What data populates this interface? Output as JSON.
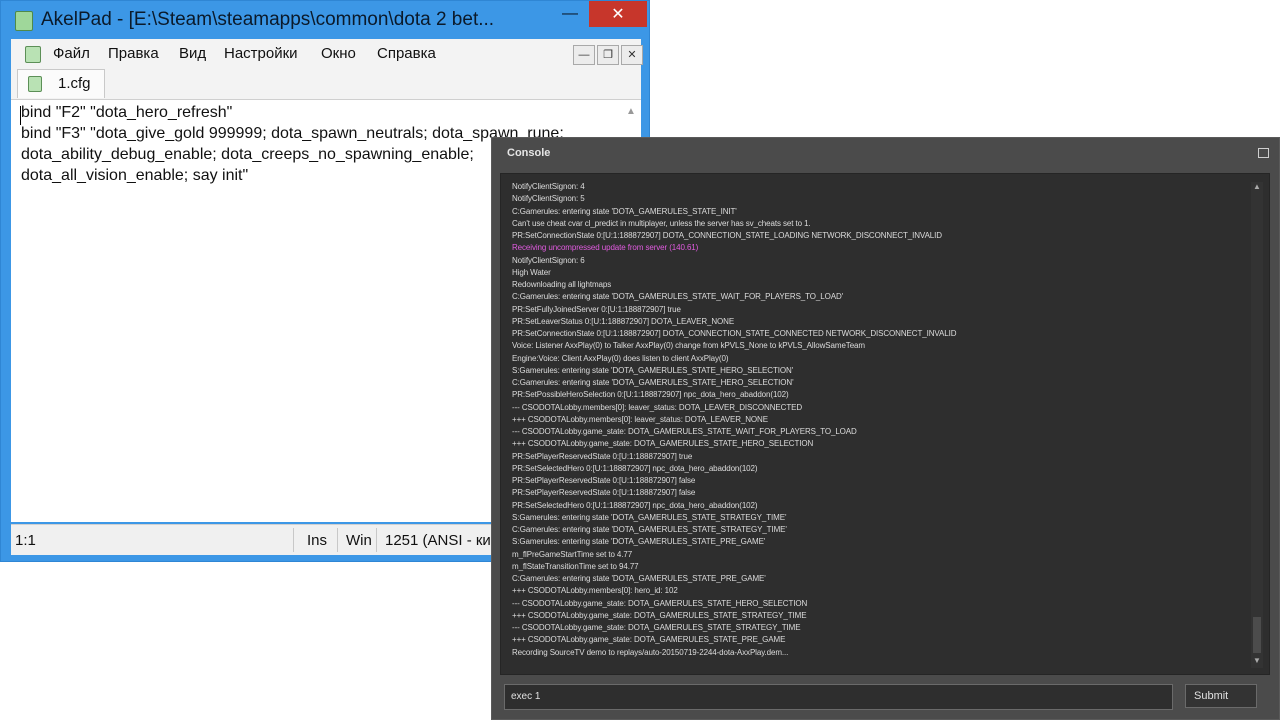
{
  "akelpad": {
    "title": "AkelPad - [E:\\Steam\\steamapps\\common\\dota 2 bet...",
    "controls": {
      "minimize": "—",
      "maximize": "☐",
      "close": "✕"
    },
    "menu": [
      "Файл",
      "Правка",
      "Вид",
      "Настройки",
      "Окно",
      "Справка"
    ],
    "mdi": {
      "minimize": "—",
      "restore": "❐",
      "close": "✕"
    },
    "tab_label": "1.cfg",
    "lines": [
      "bind \"F2\" \"dota_hero_refresh\"",
      "bind \"F3\" \"dota_give_gold 999999; dota_spawn_neutrals; dota_spawn_rune;",
      "dota_ability_debug_enable; dota_creeps_no_spawning_enable;",
      "dota_all_vision_enable; say init\""
    ],
    "status": {
      "position": "1:1",
      "mode": "Ins",
      "newline": "Win",
      "codepage": "1251  (ANSI - ки"
    }
  },
  "console": {
    "title": "Console",
    "lines": [
      {
        "text": "NotifyClientSignon: 4",
        "color": "normal"
      },
      {
        "text": "NotifyClientSignon: 5",
        "color": "normal"
      },
      {
        "text": "C:Gamerules: entering state 'DOTA_GAMERULES_STATE_INIT'",
        "color": "normal"
      },
      {
        "text": "Can't use cheat cvar cl_predict in multiplayer, unless the server has sv_cheats set to 1.",
        "color": "normal"
      },
      {
        "text": "PR:SetConnectionState 0:[U:1:188872907] DOTA_CONNECTION_STATE_LOADING NETWORK_DISCONNECT_INVALID",
        "color": "normal"
      },
      {
        "text": "Receiving uncompressed update from server (140.61)",
        "color": "pink"
      },
      {
        "text": "NotifyClientSignon: 6",
        "color": "normal"
      },
      {
        "text": "  High Water",
        "color": "normal"
      },
      {
        "text": "Redownloading all lightmaps",
        "color": "normal"
      },
      {
        "text": "C:Gamerules: entering state 'DOTA_GAMERULES_STATE_WAIT_FOR_PLAYERS_TO_LOAD'",
        "color": "normal"
      },
      {
        "text": "PR:SetFullyJoinedServer 0:[U:1:188872907] true",
        "color": "normal"
      },
      {
        "text": "PR:SetLeaverStatus 0:[U:1:188872907] DOTA_LEAVER_NONE",
        "color": "normal"
      },
      {
        "text": "PR:SetConnectionState 0:[U:1:188872907] DOTA_CONNECTION_STATE_CONNECTED NETWORK_DISCONNECT_INVALID",
        "color": "normal"
      },
      {
        "text": "Voice: Listener AxxPlay(0) to Talker AxxPlay(0) change from kPVLS_None to kPVLS_AllowSameTeam",
        "color": "normal"
      },
      {
        "text": "Engine:Voice: Client AxxPlay(0) does listen to client AxxPlay(0)",
        "color": "normal"
      },
      {
        "text": "S:Gamerules: entering state 'DOTA_GAMERULES_STATE_HERO_SELECTION'",
        "color": "normal"
      },
      {
        "text": "C:Gamerules: entering state 'DOTA_GAMERULES_STATE_HERO_SELECTION'",
        "color": "normal"
      },
      {
        "text": "PR:SetPossibleHeroSelection 0:[U:1:188872907] npc_dota_hero_abaddon(102)",
        "color": "normal"
      },
      {
        "text": "--- CSODOTALobby.members[0]: leaver_status: DOTA_LEAVER_DISCONNECTED",
        "color": "normal"
      },
      {
        "text": "+++ CSODOTALobby.members[0]: leaver_status: DOTA_LEAVER_NONE",
        "color": "normal"
      },
      {
        "text": "--- CSODOTALobby.game_state: DOTA_GAMERULES_STATE_WAIT_FOR_PLAYERS_TO_LOAD",
        "color": "normal"
      },
      {
        "text": "+++ CSODOTALobby.game_state: DOTA_GAMERULES_STATE_HERO_SELECTION",
        "color": "normal"
      },
      {
        "text": "PR:SetPlayerReservedState 0:[U:1:188872907] true",
        "color": "normal"
      },
      {
        "text": "PR:SetSelectedHero 0:[U:1:188872907] npc_dota_hero_abaddon(102)",
        "color": "normal"
      },
      {
        "text": "PR:SetPlayerReservedState 0:[U:1:188872907] false",
        "color": "normal"
      },
      {
        "text": "PR:SetPlayerReservedState 0:[U:1:188872907] false",
        "color": "normal"
      },
      {
        "text": "PR:SetSelectedHero 0:[U:1:188872907] npc_dota_hero_abaddon(102)",
        "color": "normal"
      },
      {
        "text": "S:Gamerules: entering state 'DOTA_GAMERULES_STATE_STRATEGY_TIME'",
        "color": "normal"
      },
      {
        "text": "C:Gamerules: entering state 'DOTA_GAMERULES_STATE_STRATEGY_TIME'",
        "color": "normal"
      },
      {
        "text": "S:Gamerules: entering state 'DOTA_GAMERULES_STATE_PRE_GAME'",
        "color": "normal"
      },
      {
        "text": "m_flPreGameStartTime set to 4.77",
        "color": "normal"
      },
      {
        "text": "m_flStateTransitionTime set to 94.77",
        "color": "normal"
      },
      {
        "text": "C:Gamerules: entering state 'DOTA_GAMERULES_STATE_PRE_GAME'",
        "color": "normal"
      },
      {
        "text": "+++ CSODOTALobby.members[0]: hero_id: 102",
        "color": "normal"
      },
      {
        "text": "--- CSODOTALobby.game_state: DOTA_GAMERULES_STATE_HERO_SELECTION",
        "color": "normal"
      },
      {
        "text": "+++ CSODOTALobby.game_state: DOTA_GAMERULES_STATE_STRATEGY_TIME",
        "color": "normal"
      },
      {
        "text": "--- CSODOTALobby.game_state: DOTA_GAMERULES_STATE_STRATEGY_TIME",
        "color": "normal"
      },
      {
        "text": "+++ CSODOTALobby.game_state: DOTA_GAMERULES_STATE_PRE_GAME",
        "color": "normal"
      },
      {
        "text": "Recording SourceTV demo to replays/auto-20150719-2244-dota-AxxPlay.dem...",
        "color": "normal"
      }
    ],
    "input_value": "exec 1",
    "submit_label": "Submit",
    "colors": {
      "normal": "#dcdcdc",
      "pink": "#e15be0"
    }
  }
}
